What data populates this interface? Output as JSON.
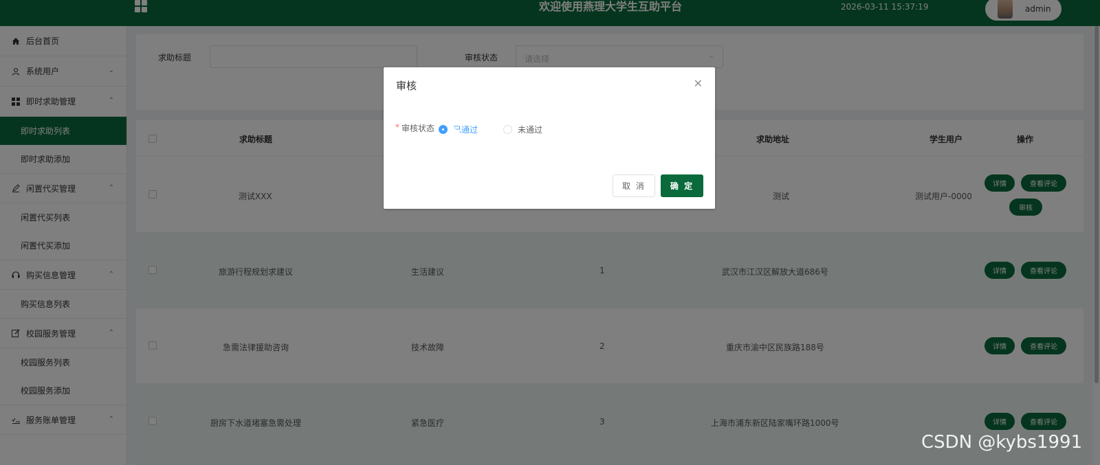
{
  "header": {
    "title": "欢迎使用燕理大学生互助平台",
    "datetime": "2026-03-11 15:37:19",
    "username": "admin"
  },
  "sidebar": {
    "items": [
      {
        "label": "后台首页",
        "icon": "home-icon"
      },
      {
        "label": "系统用户",
        "icon": "user-icon",
        "chevron": "down"
      },
      {
        "label": "即时求助管理",
        "icon": "grid-icon",
        "chevron": "up"
      },
      {
        "label": "即时求助列表",
        "sub": true,
        "active": true
      },
      {
        "label": "即时求助添加",
        "sub": true
      },
      {
        "label": "闲置代买管理",
        "icon": "pen-icon",
        "chevron": "up"
      },
      {
        "label": "闲置代买列表",
        "sub": true
      },
      {
        "label": "闲置代买添加",
        "sub": true
      },
      {
        "label": "购买信息管理",
        "icon": "headset-icon",
        "chevron": "up"
      },
      {
        "label": "购买信息列表",
        "sub": true
      },
      {
        "label": "校园服务管理",
        "icon": "edit-icon",
        "chevron": "up"
      },
      {
        "label": "校园服务列表",
        "sub": true
      },
      {
        "label": "校园服务添加",
        "sub": true
      },
      {
        "label": "服务账单管理",
        "icon": "checklist-icon",
        "chevron": "up"
      }
    ]
  },
  "search": {
    "title_label": "求助标题",
    "status_label": "审核状态",
    "status_placeholder": "请选择"
  },
  "table": {
    "columns": [
      "求助标题",
      "求助地址",
      "学生用户",
      "操作"
    ],
    "rows": [
      {
        "title": "测试XXX",
        "type": "",
        "num": "",
        "address": "测试",
        "user": "测试用户-0000",
        "buttons": [
          "详情",
          "查看评论",
          "审核"
        ]
      },
      {
        "title": "旅游行程规划求建议",
        "type": "生活建议",
        "num": "1",
        "address": "武汉市江汉区解放大道686号",
        "user": "",
        "buttons": [
          "详情",
          "查看评论"
        ]
      },
      {
        "title": "急需法律援助咨询",
        "type": "技术故障",
        "num": "2",
        "address": "重庆市渝中区民族路188号",
        "user": "",
        "buttons": [
          "详情",
          "查看评论"
        ]
      },
      {
        "title": "厨房下水道堵塞急需处理",
        "type": "紧急医疗",
        "num": "3",
        "address": "上海市浦东新区陆家嘴环路1000号",
        "user": "",
        "buttons": [
          "详情",
          "查看评论"
        ]
      }
    ]
  },
  "dialog": {
    "title": "审核",
    "field_label": "审核状态",
    "required_mark": "*",
    "options": [
      "已通过",
      "未通过"
    ],
    "selected": "已通过",
    "cancel_label": "取 消",
    "ok_label": "确 定"
  },
  "watermark": "CSDN @kybs1991",
  "colors": {
    "primary": "#0a6a3c",
    "radio_active": "#409eff"
  }
}
